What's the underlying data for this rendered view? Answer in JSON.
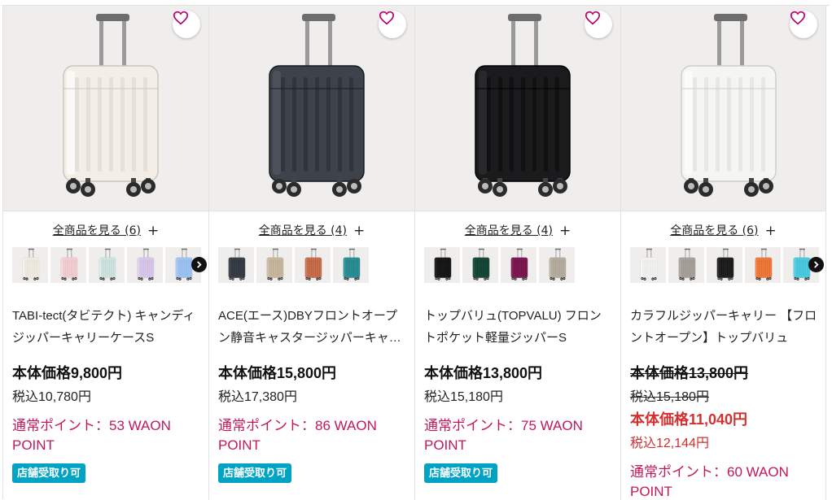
{
  "colors": {
    "points": "#c2185b",
    "sale": "#d32f2f",
    "badge": "#00a3c4"
  },
  "products": [
    {
      "see_all": "全商品を見る (6)",
      "title": "TABI-tect(タビテクト) キャンディジッパーキャリーケースS",
      "base_price": "本体価格9,800円",
      "tax_price": "税込10,780円",
      "points": "通常ポイント：53 WAON POINT",
      "badge": "店舗受取り可",
      "swatch_colors": [
        "#f1ece2",
        "#f3cfd3",
        "#cfe4df",
        "#d9c8ec",
        "#9fc4f4"
      ],
      "main_color": "#f3efe6"
    },
    {
      "see_all": "全商品を見る (4)",
      "title": "ACE(エース)DBYフロントオープン静音キャスタージッパーキャリー",
      "base_price": "本体価格15,800円",
      "tax_price": "税込17,380円",
      "points": "通常ポイント：86 WAON POINT",
      "badge": "店舗受取り可",
      "swatch_colors": [
        "#3b4048",
        "#c8b8a0",
        "#c8704e",
        "#2f8f97"
      ],
      "main_color": "#3e434b"
    },
    {
      "see_all": "全商品を見る (4)",
      "title": "トップバリュ(TOPVALU) フロントポケット軽量ジッパーS",
      "base_price": "本体価格13,800円",
      "tax_price": "税込15,180円",
      "points": "通常ポイント：75 WAON POINT",
      "badge": "店舗受取り可",
      "swatch_colors": [
        "#1a1a1a",
        "#174a3c",
        "#7e1a54",
        "#b8aea0"
      ],
      "main_color": "#1b1b1d"
    },
    {
      "see_all": "全商品を見る (6)",
      "title": "カラフルジッパーキャリー 【フロントオープン】トップバリュ",
      "orig_base_price": "本体価格13,800円",
      "orig_tax_price": "税込15,180円",
      "base_price": "本体価格11,040円",
      "tax_price": "税込12,144円",
      "points": "通常ポイント：60 WAON POINT",
      "swatch_colors": [
        "#f3f3f1",
        "#a8a29c",
        "#222222",
        "#ee7a3c",
        "#4fcbe0"
      ],
      "main_color": "#f5f5f3"
    }
  ]
}
